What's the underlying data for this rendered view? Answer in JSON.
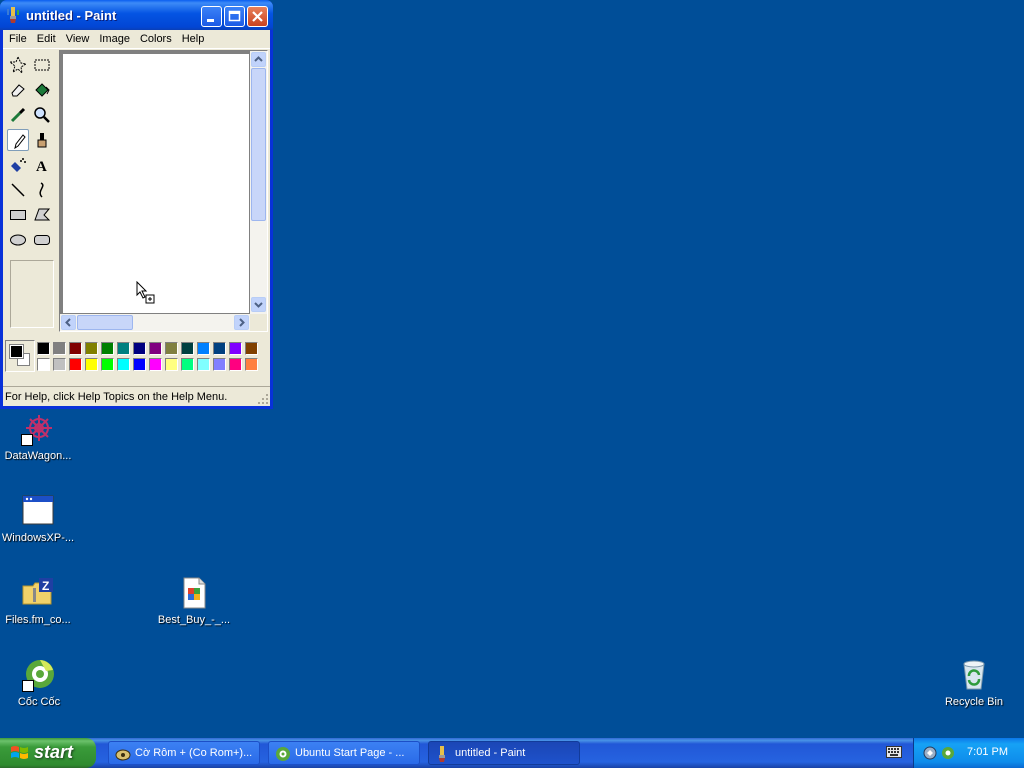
{
  "paint": {
    "title": "untitled - Paint",
    "menu": [
      "File",
      "Edit",
      "View",
      "Image",
      "Colors",
      "Help"
    ],
    "status_text": "For Help, click Help Topics on the Help Menu.",
    "tools": [
      "free-form-select",
      "select",
      "eraser",
      "fill-with-color",
      "pick-color",
      "magnifier",
      "pencil",
      "brush",
      "airbrush",
      "text",
      "line",
      "curve",
      "rectangle",
      "polygon",
      "ellipse",
      "rounded-rectangle"
    ],
    "selected_tool": "pencil",
    "foreground_color": "#000000",
    "background_color": "#ffffff",
    "palette_top": [
      "#000000",
      "#808080",
      "#800000",
      "#808000",
      "#008000",
      "#008080",
      "#000080",
      "#800080",
      "#808040",
      "#004040",
      "#0080ff",
      "#004080",
      "#8000ff",
      "#804000"
    ],
    "palette_bottom": [
      "#ffffff",
      "#c0c0c0",
      "#ff0000",
      "#ffff00",
      "#00ff00",
      "#00ffff",
      "#0000ff",
      "#ff00ff",
      "#ffff80",
      "#00ff80",
      "#80ffff",
      "#8080ff",
      "#ff0080",
      "#ff8040"
    ]
  },
  "desktop": {
    "background": "#004e98",
    "icons": [
      {
        "label": "DataWagon...",
        "icon": "datawagon-icon"
      },
      {
        "label": "WindowsXP-...",
        "icon": "window-icon"
      },
      {
        "label": "Files.fm_co...",
        "icon": "zip-folder-icon"
      },
      {
        "label": "Best_Buy_-_...",
        "icon": "document-icon"
      },
      {
        "label": "Cốc Cốc",
        "icon": "coccoc-icon"
      },
      {
        "label": "Recycle Bin",
        "icon": "recycle-bin-icon"
      }
    ]
  },
  "taskbar": {
    "start_label": "start",
    "items": [
      {
        "label": "Cờ Rôm + (Co Rom+)...",
        "icon": "cororm-icon"
      },
      {
        "label": "Ubuntu Start Page - ...",
        "icon": "coccoc-icon"
      },
      {
        "label": "untitled - Paint",
        "icon": "paint-icon",
        "active": true
      }
    ],
    "clock": "7:01 PM"
  }
}
